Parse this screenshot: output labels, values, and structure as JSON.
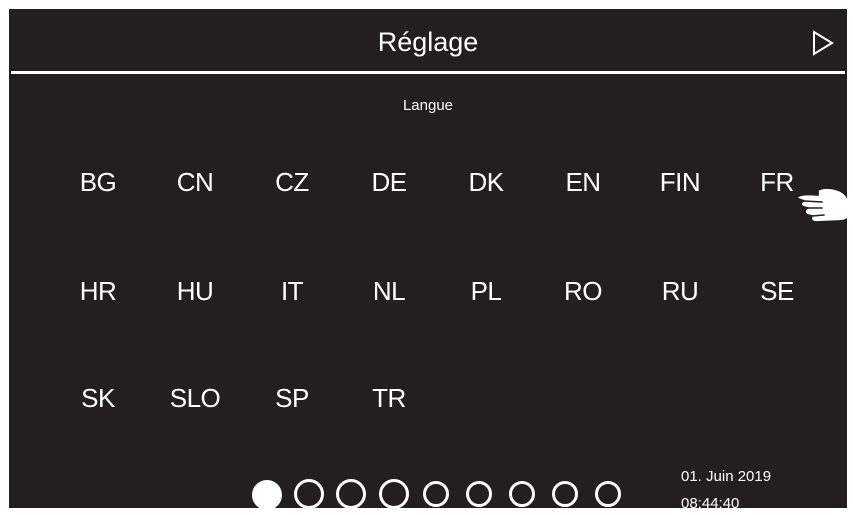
{
  "header": {
    "title": "Réglage",
    "next_icon": "play-outline-icon"
  },
  "section": {
    "label": "Langue"
  },
  "languages": [
    [
      "BG",
      "CN",
      "CZ",
      "DE",
      "DK",
      "EN",
      "FIN",
      "FR"
    ],
    [
      "HR",
      "HU",
      "IT",
      "NL",
      "PL",
      "RO",
      "RU",
      "SE"
    ],
    [
      "SK",
      "SLO",
      "SP",
      "TR"
    ]
  ],
  "pager": {
    "total_pages": 9,
    "current_page": 1
  },
  "status": {
    "date": "01. Juin 2019",
    "time": "08:44:40"
  },
  "colors": {
    "background": "#231f20",
    "foreground": "#ffffff"
  }
}
